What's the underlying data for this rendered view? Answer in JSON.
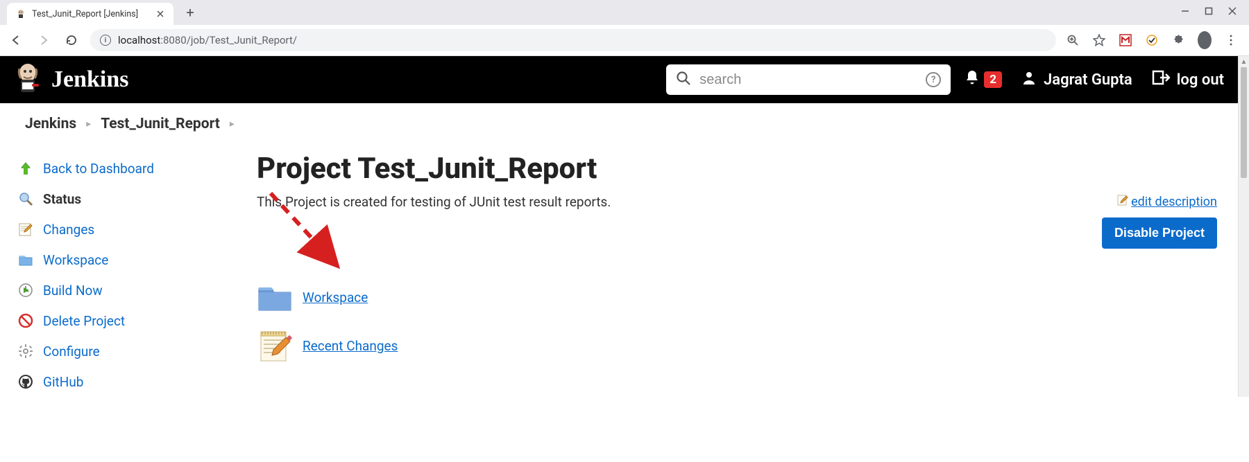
{
  "browser": {
    "tab_title": "Test_Junit_Report [Jenkins]",
    "address_host": "localhost",
    "address_port": ":8080",
    "address_path": "/job/Test_Junit_Report/"
  },
  "header": {
    "brand": "Jenkins",
    "search_placeholder": "search",
    "notif_count": "2",
    "user_name": "Jagrat Gupta",
    "logout_label": "log out"
  },
  "breadcrumb": {
    "items": [
      "Jenkins",
      "Test_Junit_Report"
    ]
  },
  "sidebar": {
    "items": [
      {
        "label": "Back to Dashboard",
        "active": false
      },
      {
        "label": "Status",
        "active": true
      },
      {
        "label": "Changes",
        "active": false
      },
      {
        "label": "Workspace",
        "active": false
      },
      {
        "label": "Build Now",
        "active": false
      },
      {
        "label": "Delete Project",
        "active": false
      },
      {
        "label": "Configure",
        "active": false
      },
      {
        "label": "GitHub",
        "active": false
      }
    ]
  },
  "content": {
    "title": "Project Test_Junit_Report",
    "description": "This Project is created for testing of JUnit test result reports.",
    "edit_description_label": "edit description",
    "disable_label": "Disable Project",
    "links": {
      "workspace": "Workspace",
      "recent_changes": "Recent Changes"
    }
  }
}
